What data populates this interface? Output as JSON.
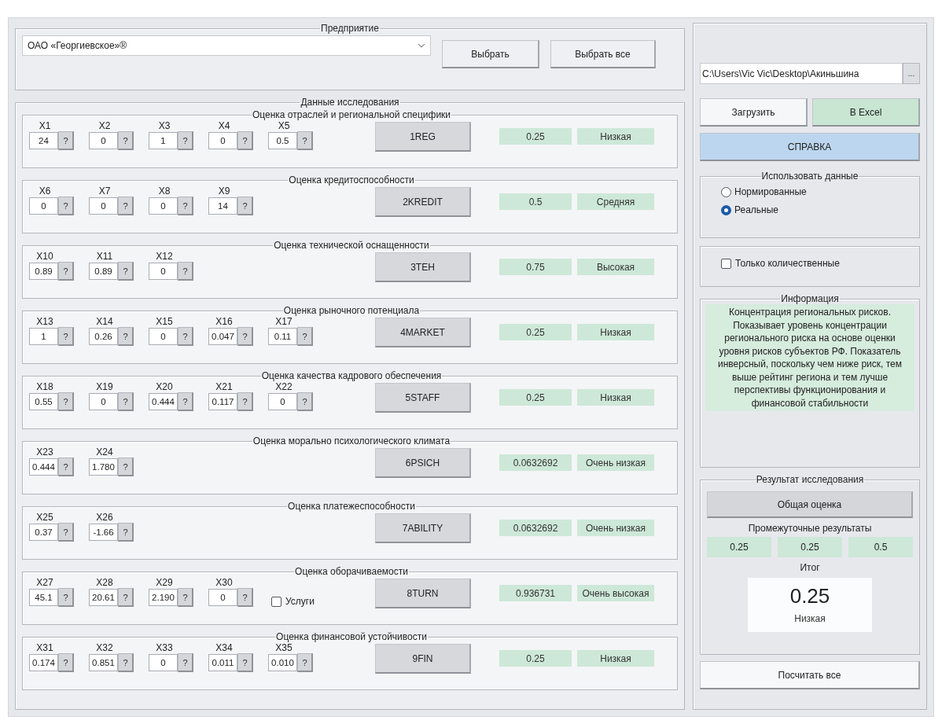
{
  "enterprise": {
    "title": "Предприятие",
    "company": "ОАО «Георгиевское»®",
    "buttons": [
      "Выбрать",
      "Выбрать все"
    ]
  },
  "research": {
    "title": "Данные исследования",
    "groups": [
      {
        "title": "Оценка отраслей и региональной специфики",
        "inputs": [
          {
            "label": "X1",
            "value": "24",
            "help": "?"
          },
          {
            "label": "X2",
            "value": "0",
            "help": "?"
          },
          {
            "label": "X3",
            "value": "1",
            "help": "?"
          },
          {
            "label": "X4",
            "value": "0",
            "help": "?"
          },
          {
            "label": "X5",
            "value": "0.5",
            "help": "?"
          }
        ],
        "button": "1REG",
        "score": "0.25",
        "rating": "Низкая"
      },
      {
        "title": "Оценка кредитоспособности",
        "inputs": [
          {
            "label": "X6",
            "value": "0",
            "help": "?"
          },
          {
            "label": "X7",
            "value": "0",
            "help": "?"
          },
          {
            "label": "X8",
            "value": "0",
            "help": "?"
          },
          {
            "label": "X9",
            "value": "14",
            "help": "?"
          }
        ],
        "button": "2KREDIT",
        "score": "0.5",
        "rating": "Средняя"
      },
      {
        "title": "Оценка технической оснащенности",
        "inputs": [
          {
            "label": "X10",
            "value": "0.89",
            "help": "?"
          },
          {
            "label": "X11",
            "value": "0.89",
            "help": "?"
          },
          {
            "label": "X12",
            "value": "0",
            "help": "?"
          }
        ],
        "button": "3TEH",
        "score": "0.75",
        "rating": "Высокая"
      },
      {
        "title": "Оценка рыночного потенциала",
        "inputs": [
          {
            "label": "X13",
            "value": "1",
            "help": "?"
          },
          {
            "label": "X14",
            "value": "0.26",
            "help": "?"
          },
          {
            "label": "X15",
            "value": "0",
            "help": "?"
          },
          {
            "label": "X16",
            "value": "0.047",
            "help": "?"
          },
          {
            "label": "X17",
            "value": "0.11",
            "help": "?"
          }
        ],
        "button": "4MARKET",
        "score": "0.25",
        "rating": "Низкая"
      },
      {
        "title": "Оценка качества кадрового обеспечения",
        "inputs": [
          {
            "label": "X18",
            "value": "0.55",
            "help": "?"
          },
          {
            "label": "X19",
            "value": "0",
            "help": "?"
          },
          {
            "label": "X20",
            "value": "0.444",
            "help": "?"
          },
          {
            "label": "X21",
            "value": "0.117",
            "help": "?"
          },
          {
            "label": "X22",
            "value": "0",
            "help": "?"
          }
        ],
        "button": "5STAFF",
        "score": "0.25",
        "rating": "Низкая"
      },
      {
        "title": "Оценка морально психологического климата",
        "inputs": [
          {
            "label": "X23",
            "value": "0.444",
            "help": "?"
          },
          {
            "label": "X24",
            "value": "1.780",
            "help": "?"
          }
        ],
        "button": "6PSICH",
        "score": "0.0632692",
        "rating": "Очень низкая"
      },
      {
        "title": "Оценка платежеспособности",
        "inputs": [
          {
            "label": "X25",
            "value": "0.37",
            "help": "?"
          },
          {
            "label": "X26",
            "value": "-1.66",
            "help": "?"
          }
        ],
        "button": "7ABILITY",
        "score": "0.0632692",
        "rating": "Очень низкая"
      },
      {
        "title": "Оценка оборачиваемости",
        "inputs": [
          {
            "label": "X27",
            "value": "45.1",
            "help": "?"
          },
          {
            "label": "X28",
            "value": "20.61",
            "help": "?"
          },
          {
            "label": "X29",
            "value": "2.190",
            "help": "?"
          },
          {
            "label": "X30",
            "value": "0",
            "help": "?"
          }
        ],
        "services": {
          "label": "Услуги",
          "checked": false
        },
        "button": "8TURN",
        "score": "0.936731",
        "rating": "Очень высокая"
      },
      {
        "title": "Оценка финансовой устойчивости",
        "inputs": [
          {
            "label": "X31",
            "value": "0.174",
            "help": "?"
          },
          {
            "label": "X32",
            "value": "0.851",
            "help": "?"
          },
          {
            "label": "X33",
            "value": "0",
            "help": "?"
          },
          {
            "label": "X34",
            "value": "0.011",
            "help": "?"
          },
          {
            "label": "X35",
            "value": "0.010",
            "help": "?"
          }
        ],
        "button": "9FIN",
        "score": "0.25",
        "rating": "Низкая"
      }
    ]
  },
  "file": {
    "path": "C:\\Users\\Vic Vic\\Desktop\\Акиньшина",
    "browse": "..."
  },
  "actions": [
    {
      "label": "Загрузить",
      "kind": "load"
    },
    {
      "label": "В Excel",
      "kind": "excel"
    }
  ],
  "help": "СПРАВКА",
  "data_mode": {
    "title": "Использовать данные",
    "options": [
      {
        "label": "Нормированные",
        "selected": false
      },
      {
        "label": "Реальные",
        "selected": true
      }
    ]
  },
  "quantitative_only": {
    "label": "Только количественные",
    "checked": false
  },
  "info": {
    "title": "Информация",
    "text": "Концентрация региональных рисков. Показывает уровень концентрации регионального риска на основе оценки уровня рисков субъектов РФ. Показатель инверсный, поскольку чем ниже риск, тем выше рейтинг региона и тем лучше перспективы функционирования и финансовой стабильности"
  },
  "result": {
    "title": "Результат исследования",
    "button": "Общая оценка",
    "intermediate_title": "Промежуточные результаты",
    "intermediate": [
      "0.25",
      "0.25",
      "0.5"
    ],
    "total_title": "Итог",
    "total": "0.25",
    "total_rating": "Низкая"
  },
  "calculate_all": "Посчитать все"
}
